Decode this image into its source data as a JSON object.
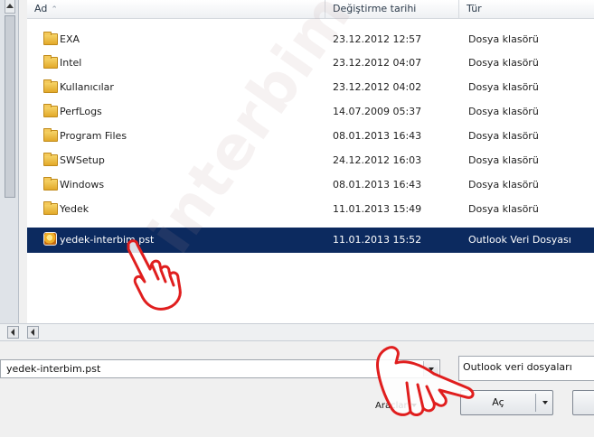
{
  "columns": {
    "name": "Ad",
    "date": "Değiştirme tarihi",
    "type": "Tür"
  },
  "files": [
    {
      "name": "EXA",
      "date": "23.12.2012 12:57",
      "type": "Dosya klasörü",
      "icon": "folder-icon"
    },
    {
      "name": "Intel",
      "date": "23.12.2012 04:07",
      "type": "Dosya klasörü",
      "icon": "folder-icon"
    },
    {
      "name": "Kullanıcılar",
      "date": "23.12.2012 04:02",
      "type": "Dosya klasörü",
      "icon": "folder-icon"
    },
    {
      "name": "PerfLogs",
      "date": "14.07.2009 05:37",
      "type": "Dosya klasörü",
      "icon": "folder-icon"
    },
    {
      "name": "Program Files",
      "date": "08.01.2013 16:43",
      "type": "Dosya klasörü",
      "icon": "folder-icon"
    },
    {
      "name": "SWSetup",
      "date": "24.12.2012 16:03",
      "type": "Dosya klasörü",
      "icon": "folder-icon"
    },
    {
      "name": "Windows",
      "date": "08.01.2013 16:43",
      "type": "Dosya klasörü",
      "icon": "folder-icon"
    },
    {
      "name": "Yedek",
      "date": "11.01.2013 15:49",
      "type": "Dosya klasörü",
      "icon": "folder-icon"
    },
    {
      "name": "yedek-interbim.pst",
      "date": "11.01.2013 15:52",
      "type": "Outlook Veri Dosyası",
      "icon": "outlook-pst-icon",
      "selected": true
    }
  ],
  "filename_value": "yedek-interbim.pst",
  "filetype_value": "Outlook veri dosyaları",
  "tools_label": "Araçlar",
  "open_label": "Aç",
  "watermark": "interbim",
  "colors": {
    "selection": "#0c2a5f",
    "annotation": "#e01e1e"
  }
}
